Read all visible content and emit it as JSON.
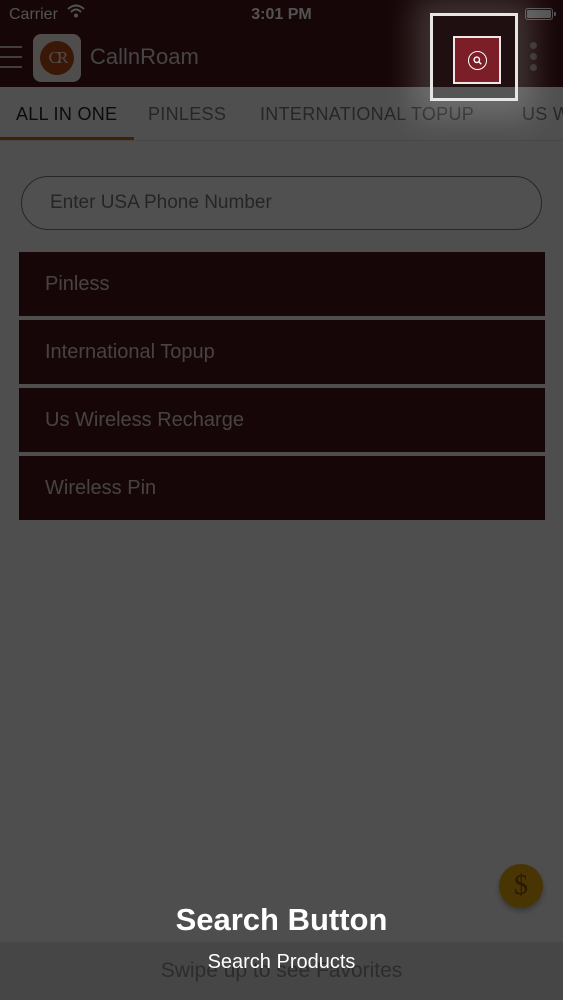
{
  "status_bar": {
    "carrier": "Carrier",
    "time": "3:01 PM"
  },
  "app_bar": {
    "logo_text": "CR",
    "title": "CallnRoam"
  },
  "tabs": [
    {
      "label": "ALL IN ONE",
      "active": true
    },
    {
      "label": "PINLESS",
      "active": false
    },
    {
      "label": "INTERNATIONAL TOPUP",
      "active": false
    },
    {
      "label": "US W",
      "active": false
    }
  ],
  "phone_input": {
    "placeholder": "Enter USA Phone Number",
    "value": ""
  },
  "products": [
    {
      "label": "Pinless"
    },
    {
      "label": "International Topup"
    },
    {
      "label": "Us Wireless Recharge"
    },
    {
      "label": "Wireless Pin"
    }
  ],
  "coin_symbol": "$",
  "bottom_bar": {
    "label": "Swipe up to see Favorites"
  },
  "coach_mark": {
    "title": "Search Button",
    "subtitle": "Search Products"
  },
  "colors": {
    "brand": "#4a1418",
    "accent": "#c06a16",
    "search_button": "#7c1e28",
    "coin": "#e2a10e"
  }
}
